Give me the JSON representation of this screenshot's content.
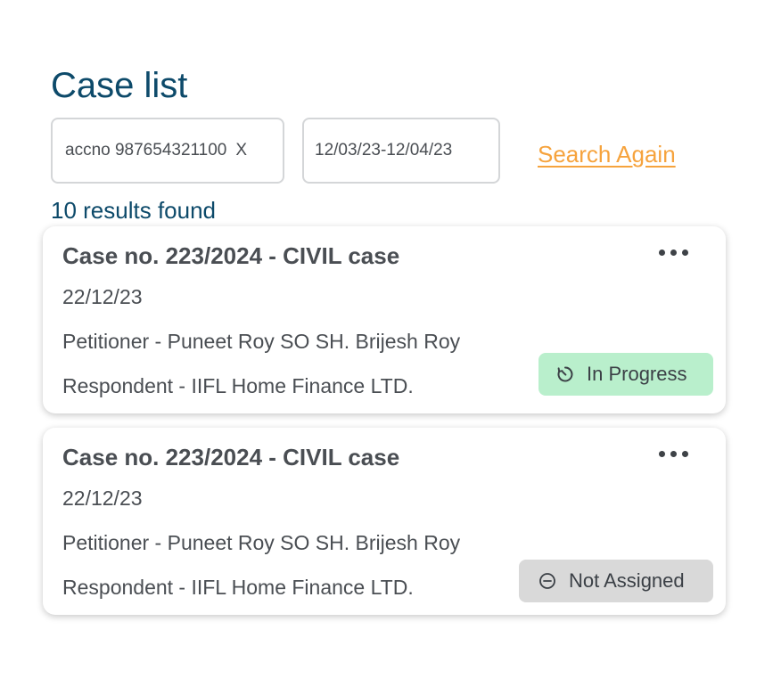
{
  "header": {
    "title": "Case list"
  },
  "filters": {
    "search_value": "accno 987654321100",
    "clear_label": "X",
    "date_range": "12/03/23-12/04/23",
    "search_again_label": "Search Again"
  },
  "results_text": "10 results found",
  "cases": [
    {
      "title": "Case no. 223/2024 - CIVIL case",
      "date": "22/12/23",
      "petitioner": "Petitioner - Puneet Roy SO SH. Brijesh Roy",
      "respondent": "Respondent - IIFL Home Finance LTD.",
      "status": "In Progress",
      "status_icon": "timer-icon",
      "status_color": "#b9efcc"
    },
    {
      "title": "Case no. 223/2024 - CIVIL case",
      "date": "22/12/23",
      "petitioner": "Petitioner - Puneet Roy SO SH. Brijesh Roy",
      "respondent": "Respondent - IIFL Home Finance LTD.",
      "status": "Not Assigned",
      "status_icon": "minus-circle-icon",
      "status_color": "#d9d9d9"
    }
  ],
  "colors": {
    "title": "#0d4a6a",
    "accent": "#f6a33d",
    "text": "#4a4e53"
  }
}
